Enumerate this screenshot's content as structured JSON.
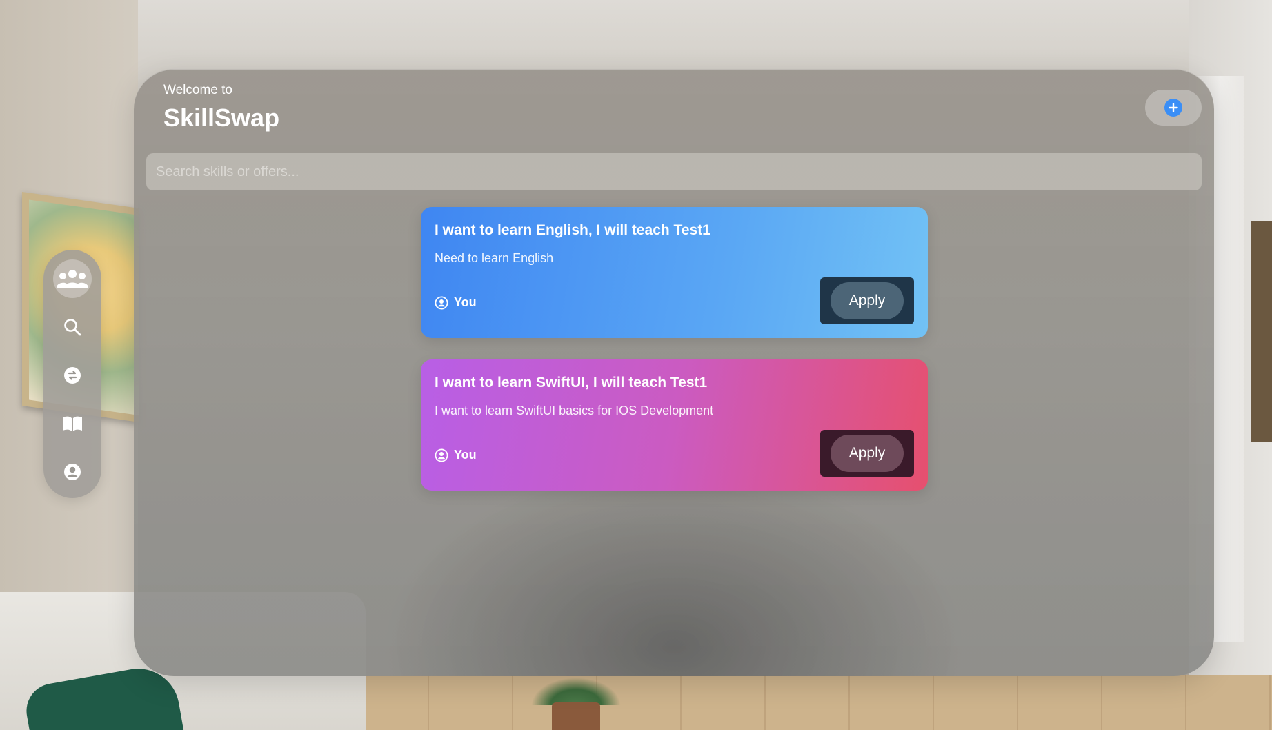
{
  "header": {
    "welcome_text": "Welcome to",
    "app_title": "SkillSwap"
  },
  "search": {
    "placeholder": "Search skills or offers..."
  },
  "toolbar": {
    "add_icon": "plus-circle-icon",
    "accent_color": "#3a8ef6"
  },
  "sidebar": {
    "items": [
      {
        "icon": "people-icon",
        "active": true
      },
      {
        "icon": "search-icon",
        "active": false
      },
      {
        "icon": "swap-icon",
        "active": false
      },
      {
        "icon": "book-icon",
        "active": false
      },
      {
        "icon": "person-icon",
        "active": false
      }
    ]
  },
  "offers": [
    {
      "title": "I want to learn English, I will teach Test1",
      "description": "Need to learn English",
      "user": "You",
      "action_label": "Apply",
      "color_start": "#3f86f2",
      "color_end": "#72c2f5"
    },
    {
      "title": "I want to learn SwiftUI, I will teach Test1",
      "description": "I want to learn SwiftUI basics for IOS Development",
      "user": "You",
      "action_label": "Apply",
      "color_start": "#b85fe6",
      "color_end": "#e6506e"
    }
  ]
}
